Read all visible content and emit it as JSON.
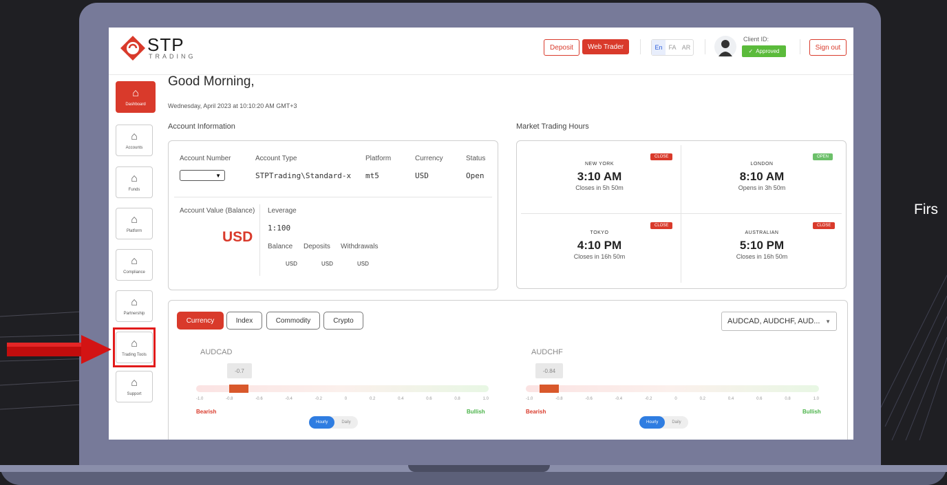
{
  "brand": {
    "name": "STP",
    "sub": "TRADING"
  },
  "header": {
    "deposit": "Deposit",
    "web_trader": "Web Trader",
    "languages": [
      "En",
      "FA",
      "AR"
    ],
    "client_id_label": "Client ID:",
    "status": "Approved",
    "sign_out": "Sign out"
  },
  "sidebar": {
    "items": [
      {
        "label": "Dashboard",
        "active": true
      },
      {
        "label": "Accounts"
      },
      {
        "label": "Funds"
      },
      {
        "label": "Platform"
      },
      {
        "label": "Compliance"
      },
      {
        "label": "Partnership"
      },
      {
        "label": "Trading Tools"
      },
      {
        "label": "Support"
      }
    ]
  },
  "greeting": {
    "title": "Good Morning,",
    "date": "Wednesday, April   2023 at 10:10:20 AM GMT+3"
  },
  "account": {
    "section_label": "Account Information",
    "headers": [
      "Account Number",
      "Account Type",
      "Platform",
      "Currency",
      "Status"
    ],
    "row": {
      "type": "STPTrading\\Standard-x",
      "platform": "mt5",
      "currency": "USD",
      "status": "Open"
    },
    "value_label": "Account Value (Balance)",
    "value_currency": "USD",
    "leverage_label": "Leverage",
    "leverage_value": "1:100",
    "sub_headers": [
      "Balance",
      "Deposits",
      "Withdrawals"
    ],
    "sub_values": [
      "USD",
      "USD",
      "USD"
    ]
  },
  "market": {
    "section_label": "Market Trading Hours",
    "cells": [
      {
        "city": "NEW YORK",
        "time": "3:10 AM",
        "note": "Closes in 5h 50m",
        "badge": "CLOSE"
      },
      {
        "city": "LONDON",
        "time": "8:10 AM",
        "note": "Opens in 3h 50m",
        "badge": "OPEN"
      },
      {
        "city": "TOKYO",
        "time": "4:10 PM",
        "note": "Closes in 16h 50m",
        "badge": "CLOSE"
      },
      {
        "city": "AUSTRALIAN",
        "time": "5:10 PM",
        "note": "Closes in 16h 50m",
        "badge": "CLOSE"
      }
    ]
  },
  "tools": {
    "tabs": [
      "Currency",
      "Index",
      "Commodity",
      "Crypto"
    ],
    "select_value": "AUDCAD, AUDCHF, AUD...",
    "gauges": [
      {
        "pair": "AUDCAD",
        "value": "-0.7"
      },
      {
        "pair": "AUDCHF",
        "value": "-0.84"
      }
    ],
    "scale": [
      "-1.0",
      "-0.8",
      "-0.6",
      "-0.4",
      "-0.2",
      "0",
      "0.2",
      "0.4",
      "0.6",
      "0.8",
      "1.0"
    ],
    "bearish": "Bearish",
    "bullish": "Bullish",
    "toggle_on": "Hourly",
    "toggle_off": "Daily"
  },
  "outside_text": "Firs",
  "colors": {
    "brand_red": "#d93a2b",
    "approved_green": "#5bbb3b",
    "open_green": "#6cc06a",
    "toggle_blue": "#2f7de1"
  }
}
